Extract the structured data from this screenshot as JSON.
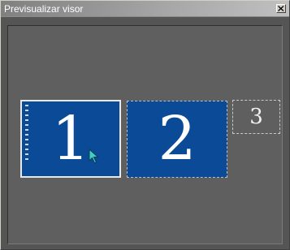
{
  "window": {
    "title": "Previsualizar visor",
    "close_icon": "close-x-icon"
  },
  "monitors": [
    {
      "label": "1",
      "active": true,
      "color": "#0a4a96"
    },
    {
      "label": "2",
      "active": false,
      "color": "#0a4a96"
    },
    {
      "label": "3",
      "active": false,
      "color": "#5f5f5f"
    }
  ],
  "cursor_icon": "pointer-arrow-icon"
}
